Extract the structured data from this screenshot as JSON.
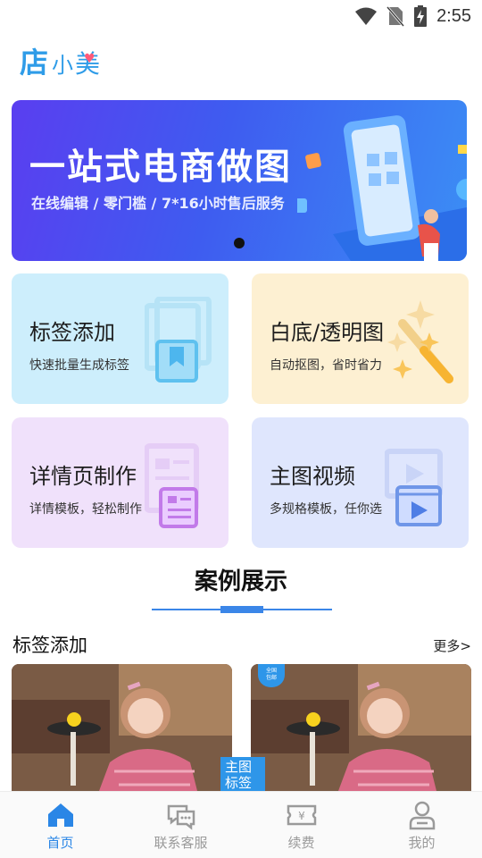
{
  "status_bar": {
    "time": "2:55",
    "icons": [
      "wifi-icon",
      "no-sim-icon",
      "battery-charging-icon"
    ]
  },
  "logo": {
    "text_1": "店",
    "text_2": "小",
    "text_3": "美"
  },
  "banner": {
    "title": "一站式电商做图",
    "subtitle": "在线编辑 / 零门槛 / 7*16小时售后服务",
    "accent": "#3e5cf0"
  },
  "features": [
    {
      "title": "标签添加",
      "desc": "快速批量生成标签",
      "icon": "bookmark-icon"
    },
    {
      "title": "白底/透明图",
      "desc": "自动抠图，省时省力",
      "icon": "magic-wand-icon"
    },
    {
      "title": "详情页制作",
      "desc": "详情模板，轻松制作",
      "icon": "document-icon"
    },
    {
      "title": "主图视频",
      "desc": "多规格模板，任你选",
      "icon": "video-icon"
    }
  ],
  "cases": {
    "title": "案例展示",
    "section": "标签添加",
    "more": "更多>",
    "label": "主图\n标签",
    "badge": "全国\n包邮"
  },
  "nav": [
    {
      "label": "首页",
      "icon": "home-icon",
      "active": true
    },
    {
      "label": "联系客服",
      "icon": "chat-icon",
      "active": false
    },
    {
      "label": "续费",
      "icon": "ticket-icon",
      "active": false
    },
    {
      "label": "我的",
      "icon": "user-icon",
      "active": false
    }
  ],
  "colors": {
    "brand": "#2f9ce8",
    "nav_active": "#2a86e6",
    "nav_inactive": "#9a9a9a"
  }
}
